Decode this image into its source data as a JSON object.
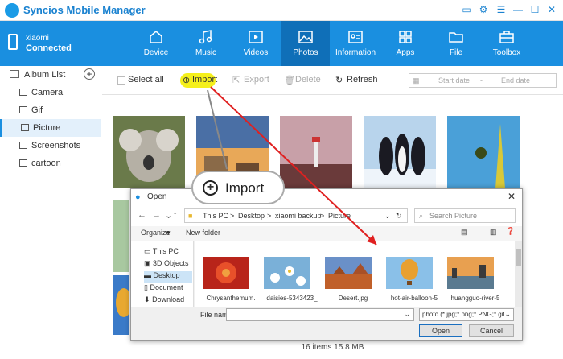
{
  "app": {
    "title": "Syncios Mobile Manager",
    "brand_color": "#1a8fe0"
  },
  "device": {
    "name": "xiaomi",
    "status": "Connected"
  },
  "nav": [
    {
      "label": "Device",
      "icon": "home-icon"
    },
    {
      "label": "Music",
      "icon": "music-icon"
    },
    {
      "label": "Videos",
      "icon": "film-icon"
    },
    {
      "label": "Photos",
      "icon": "image-icon",
      "active": true
    },
    {
      "label": "Information",
      "icon": "contact-icon"
    },
    {
      "label": "Apps",
      "icon": "apps-icon"
    },
    {
      "label": "File",
      "icon": "folder-icon"
    },
    {
      "label": "Toolbox",
      "icon": "toolbox-icon"
    }
  ],
  "sidebar": {
    "header": "Album List",
    "items": [
      {
        "label": "Camera"
      },
      {
        "label": "Gif"
      },
      {
        "label": "Picture",
        "active": true
      },
      {
        "label": "Screenshots"
      },
      {
        "label": "cartoon"
      }
    ]
  },
  "toolbar": {
    "select_all": "Select all",
    "import": "Import",
    "export": "Export",
    "delete": "Delete",
    "refresh": "Refresh",
    "start_date": "Start date",
    "date_sep": "-",
    "end_date": "End date"
  },
  "callout": {
    "label": "Import"
  },
  "status_bar": "16 items 15.8 MB",
  "dialog": {
    "title": "Open",
    "breadcrumb": [
      "This PC",
      ">",
      "Desktop",
      ">",
      "xiaomi backup",
      ">",
      "Picture"
    ],
    "search_placeholder": "Search Picture",
    "organize": "Organize",
    "new_folder": "New folder",
    "nav_items": [
      "This PC",
      "3D Objects",
      "Desktop",
      "Document",
      "Download"
    ],
    "files": [
      {
        "name": "Chrysanthemum."
      },
      {
        "name": "daisies-5343423_"
      },
      {
        "name": "Desert.jpg"
      },
      {
        "name": "hot-air-balloon-5"
      },
      {
        "name": "huangguo-river-5"
      }
    ],
    "filename_label": "File name:",
    "filter": "photo (*.jpg;*.png;*.PNG;*.gif;*",
    "open": "Open",
    "cancel": "Cancel"
  }
}
